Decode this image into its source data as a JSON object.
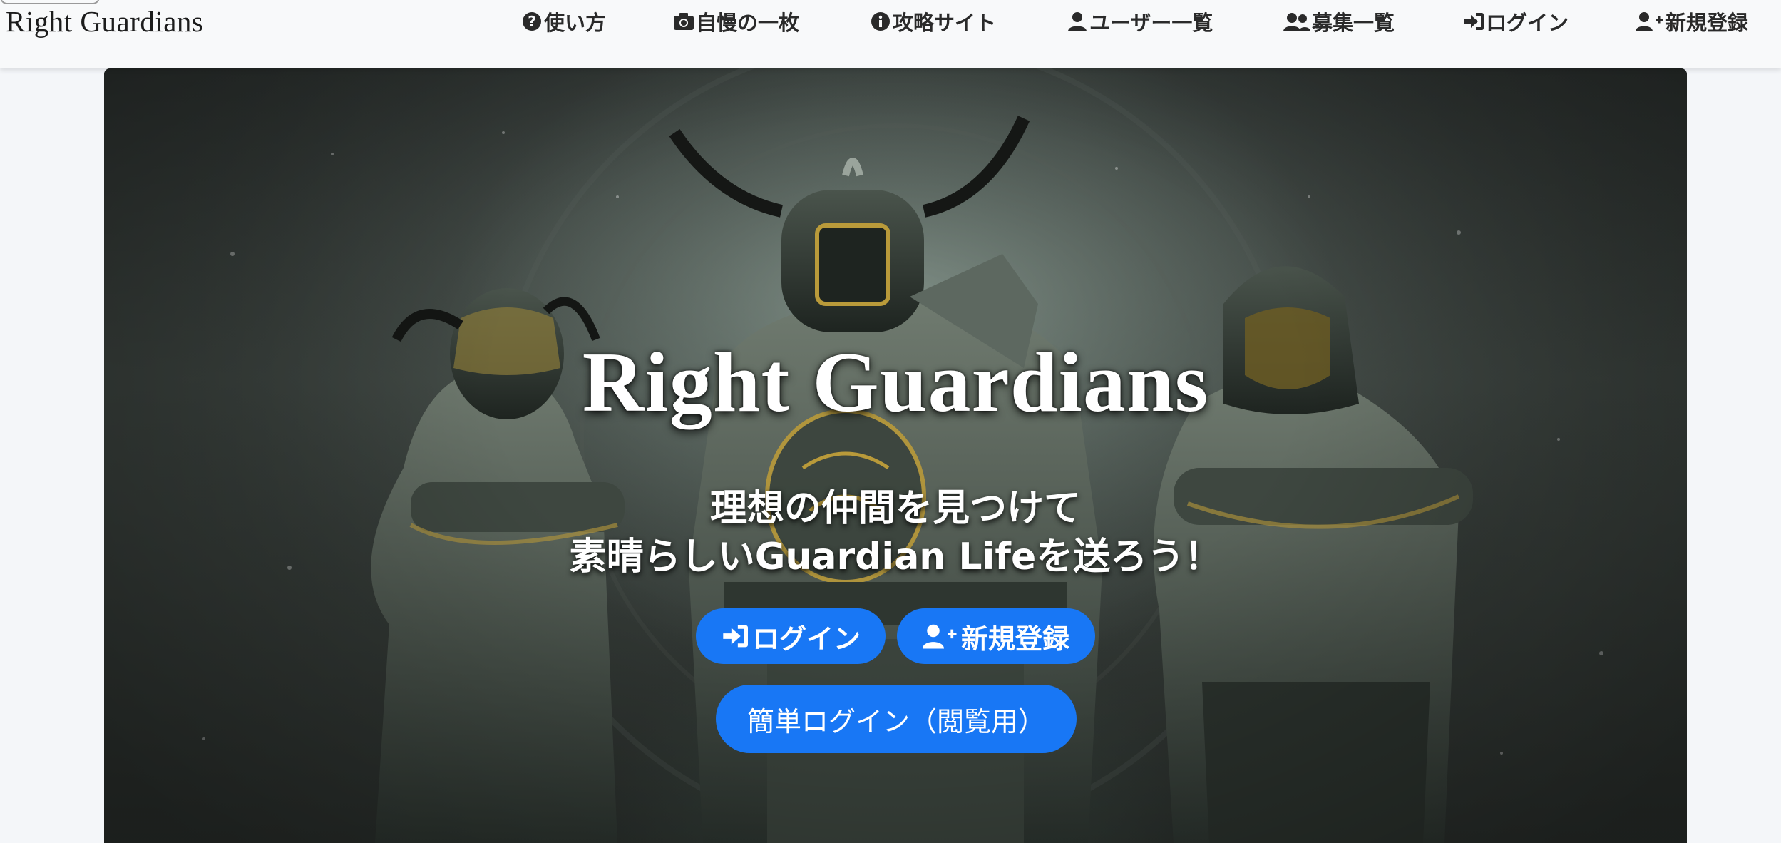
{
  "navbar": {
    "brand": "Right Guardians",
    "items": [
      {
        "label": "使い方",
        "icon": "question-circle-icon"
      },
      {
        "label": "自慢の一枚",
        "icon": "camera-icon"
      },
      {
        "label": "攻略サイト",
        "icon": "info-circle-icon"
      },
      {
        "label": "ユーザー一覧",
        "icon": "user-icon"
      },
      {
        "label": "募集一覧",
        "icon": "users-icon"
      },
      {
        "label": "ログイン",
        "icon": "sign-in-icon"
      },
      {
        "label": "新規登録",
        "icon": "user-plus-icon"
      }
    ]
  },
  "hero": {
    "title": "Right Guardians",
    "subtitle_line1": "理想の仲間を見つけて",
    "subtitle_line2": "素晴らしいGuardian Lifeを送ろう！",
    "login_label": "ログイン",
    "signup_label": "新規登録",
    "guest_login_label": "簡単ログイン（閲覧用）"
  },
  "colors": {
    "button": "#1877f5",
    "navbar_bg": "#f8f9fa",
    "nav_text": "#2a2a2a"
  }
}
